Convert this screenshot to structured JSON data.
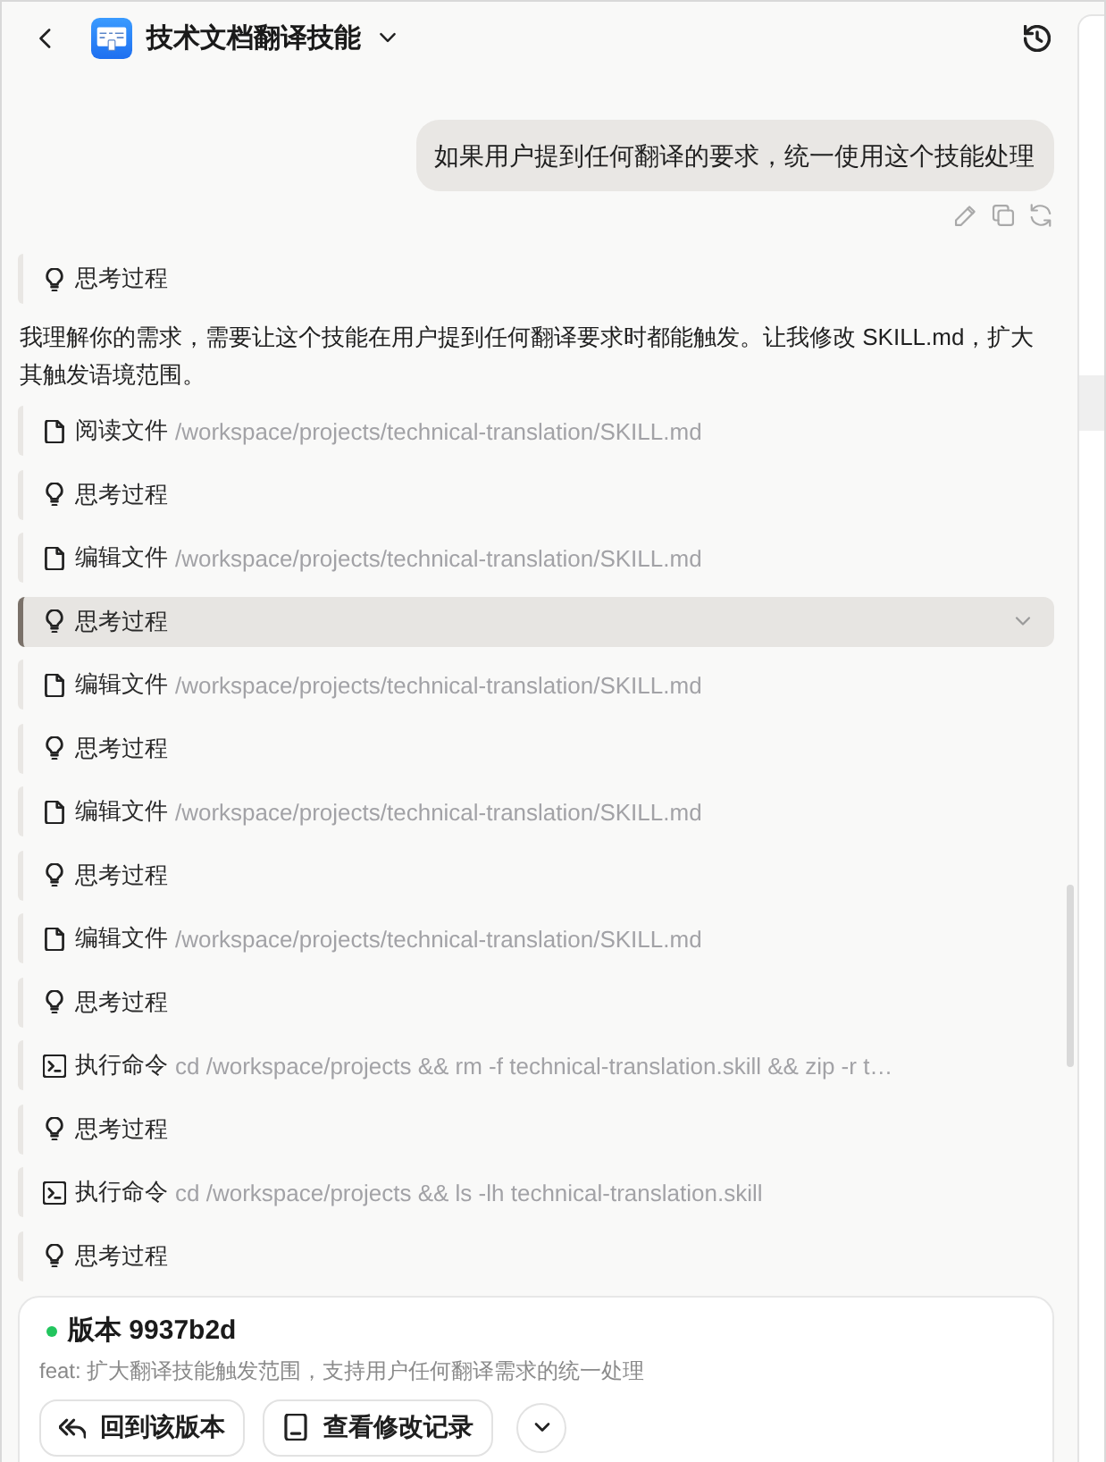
{
  "header": {
    "title": "技术文档翻译技能"
  },
  "user_message": {
    "text": "如果用户提到任何翻译的要求，统一使用这个技能处理"
  },
  "reply": {
    "lead_steps": [
      {
        "kind": "thinking",
        "label": "思考过程",
        "selected": false
      }
    ],
    "text": "我理解你的需求，需要让这个技能在用户提到任何翻译要求时都能触发。让我修改 SKILL.md，扩大其触发语境范围。",
    "steps": [
      {
        "kind": "file",
        "label": "阅读文件",
        "detail": "/workspace/projects/technical-translation/SKILL.md",
        "selected": false
      },
      {
        "kind": "thinking",
        "label": "思考过程",
        "selected": false
      },
      {
        "kind": "file",
        "label": "编辑文件",
        "detail": "/workspace/projects/technical-translation/SKILL.md",
        "selected": false
      },
      {
        "kind": "thinking",
        "label": "思考过程",
        "selected": true
      },
      {
        "kind": "file",
        "label": "编辑文件",
        "detail": "/workspace/projects/technical-translation/SKILL.md",
        "selected": false
      },
      {
        "kind": "thinking",
        "label": "思考过程",
        "selected": false
      },
      {
        "kind": "file",
        "label": "编辑文件",
        "detail": "/workspace/projects/technical-translation/SKILL.md",
        "selected": false
      },
      {
        "kind": "thinking",
        "label": "思考过程",
        "selected": false
      },
      {
        "kind": "file",
        "label": "编辑文件",
        "detail": "/workspace/projects/technical-translation/SKILL.md",
        "selected": false
      },
      {
        "kind": "thinking",
        "label": "思考过程",
        "selected": false
      },
      {
        "kind": "command",
        "label": "执行命令",
        "detail": "cd /workspace/projects && rm -f technical-translation.skill && zip -r t…",
        "selected": false
      },
      {
        "kind": "thinking",
        "label": "思考过程",
        "selected": false
      },
      {
        "kind": "command",
        "label": "执行命令",
        "detail": "cd /workspace/projects && ls -lh technical-translation.skill",
        "selected": false
      },
      {
        "kind": "thinking",
        "label": "思考过程",
        "selected": false
      }
    ]
  },
  "version_card": {
    "title": "版本 9937b2d",
    "message": "feat: 扩大翻译技能触发范围，支持用户任何翻译需求的统一处理",
    "buttons": [
      {
        "kind": "revert",
        "label": "回到该版本"
      },
      {
        "kind": "history",
        "label": "查看修改记录"
      }
    ]
  }
}
